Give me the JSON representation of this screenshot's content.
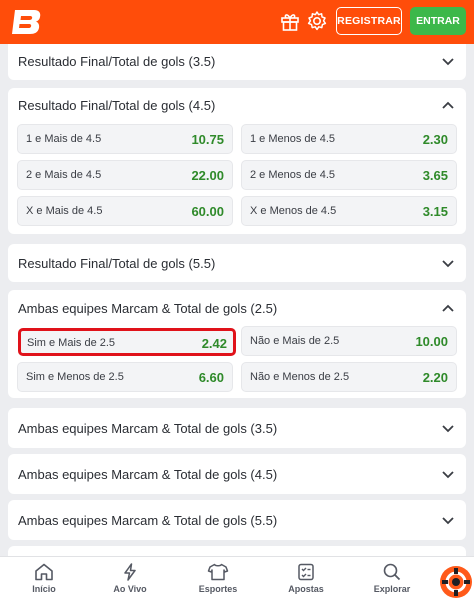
{
  "header": {
    "registrar": "REGISTRAR",
    "entrar": "ENTRAR"
  },
  "sections": [
    {
      "title": "Resultado Final/Total de gols (3.5)"
    },
    {
      "title": "Resultado Final/Total de gols (4.5)",
      "options": [
        {
          "label": "1 e Mais de 4.5",
          "odd": "10.75"
        },
        {
          "label": "1 e Menos de 4.5",
          "odd": "2.30"
        },
        {
          "label": "2 e Mais de 4.5",
          "odd": "22.00"
        },
        {
          "label": "2 e Menos de 4.5",
          "odd": "3.65"
        },
        {
          "label": "X e Mais de 4.5",
          "odd": "60.00"
        },
        {
          "label": "X e Menos de 4.5",
          "odd": "3.15"
        }
      ]
    },
    {
      "title": "Resultado Final/Total de gols (5.5)"
    },
    {
      "title": "Ambas equipes Marcam & Total de gols (2.5)",
      "options": [
        {
          "label": "Sim e Mais de 2.5",
          "odd": "2.42"
        },
        {
          "label": "Não e Mais de 2.5",
          "odd": "10.00"
        },
        {
          "label": "Sim e Menos de 2.5",
          "odd": "6.60"
        },
        {
          "label": "Não e Menos de 2.5",
          "odd": "2.20"
        }
      ]
    },
    {
      "title": "Ambas equipes Marcam & Total de gols (3.5)"
    },
    {
      "title": "Ambas equipes Marcam & Total de gols (4.5)"
    },
    {
      "title": "Ambas equipes Marcam & Total de gols (5.5)"
    }
  ],
  "nav": [
    {
      "label": "Início"
    },
    {
      "label": "Ao Vivo"
    },
    {
      "label": "Esportes"
    },
    {
      "label": "Apostas"
    },
    {
      "label": "Explorar"
    }
  ],
  "colors": {
    "brand": "#ff4d0a",
    "odd": "#2f8a2a",
    "highlight": "#e0121a",
    "entrar": "#3cb84a"
  },
  "icons": [
    "logo-b",
    "gift-icon",
    "gear-icon",
    "chevron-down-icon",
    "chevron-up-icon",
    "home-icon",
    "lightning-icon",
    "shirt-icon",
    "betslip-icon",
    "search-icon",
    "chat-icon"
  ]
}
